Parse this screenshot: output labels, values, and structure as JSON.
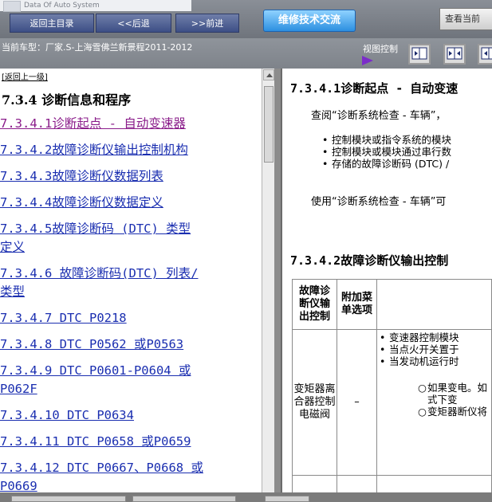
{
  "brand": {
    "subtitle": "Data Of Auto System"
  },
  "nav": {
    "home": "返回主目录",
    "back": "<<后退",
    "forward": ">>前进",
    "tech": "维修技术交流",
    "view_current": "查看当前"
  },
  "info": {
    "car_model": "当前车型：厂家.S-上海雪佛兰新景程2011-2012",
    "view_control": "视图控制"
  },
  "left": {
    "back_link": "[返回上一级]",
    "heading": "7.3.4 诊断信息和程序",
    "items": [
      " 7.3.4.1诊断起点 - 自动变速器",
      " 7.3.4.2故障诊断仪输出控制机构",
      " 7.3.4.3故障诊断仪数据列表",
      " 7.3.4.4故障诊断仪数据定义",
      " 7.3.4.5故障诊断码 (DTC) 类型",
      "定义",
      " 7.3.4.6 故障诊断码(DTC) 列表/",
      "类型",
      " 7.3.4.7 DTC P0218",
      " 7.3.4.8 DTC P0562 或P0563",
      " 7.3.4.9 DTC P0601-P0604 或",
      "P062F",
      " 7.3.4.10 DTC P0634",
      " 7.3.4.11 DTC P0658 或P0659",
      " 7.3.4.12 DTC P0667、P0668 或",
      "P0669"
    ]
  },
  "right": {
    "h1": "7.3.4.1诊断起点 - 自动变速",
    "p1": "查阅“诊断系统检查 - 车辆”，",
    "bullets": [
      "控制模块或指令系统的模块",
      "控制模块或模块通过串行数",
      "存储的故障诊断码 (DTC) /"
    ],
    "p2": "使用“诊断系统检查 - 车辆”可",
    "h2": "7.3.4.2故障诊断仪输出控制",
    "table": {
      "headers": [
        "故障诊断仪输出控制",
        "附加菜单选项",
        ""
      ],
      "row1": {
        "name": "变矩器离合器控制电磁阀",
        "option": "–",
        "bullets": [
          "变速器控制模块",
          "当点火开关置于",
          "当发动机运行时"
        ],
        "sub": [
          "如果变电。如式下变",
          "变矩器断仪将"
        ]
      }
    }
  }
}
